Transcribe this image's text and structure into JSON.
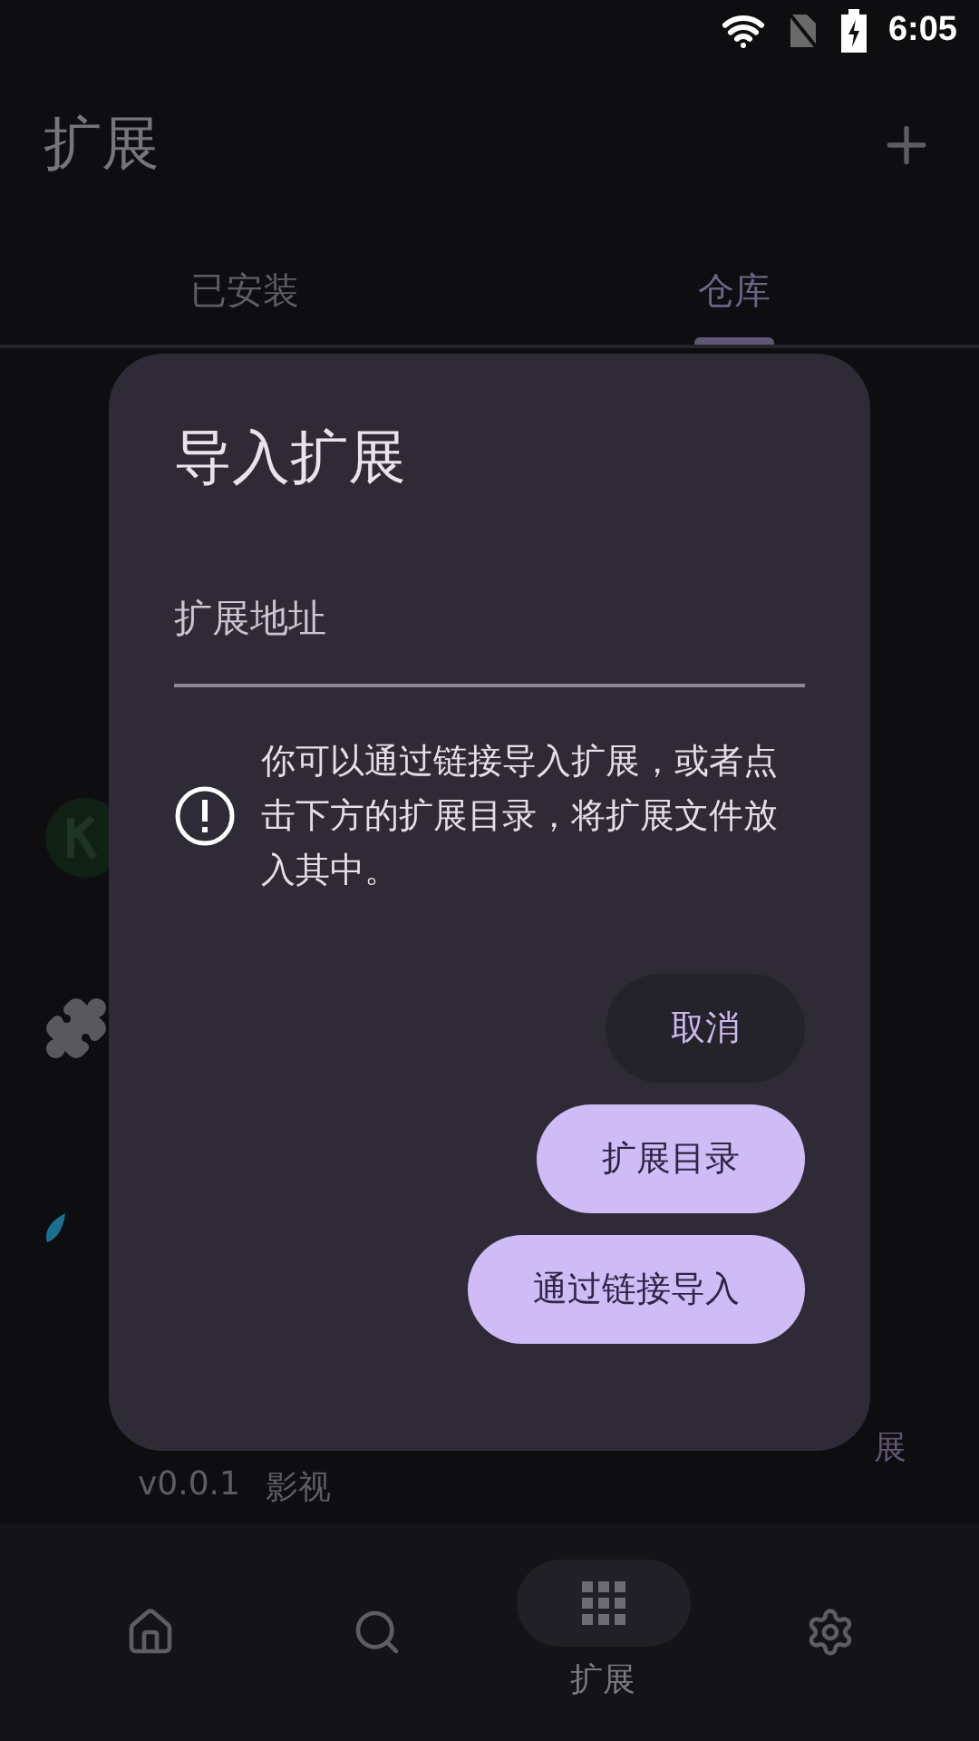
{
  "status_bar": {
    "time": "6:05"
  },
  "app_bar": {
    "title": "扩展"
  },
  "tabs": [
    {
      "label": "已安装",
      "selected": false
    },
    {
      "label": "仓库",
      "selected": true
    }
  ],
  "list_peek": {
    "version": "v0.0.1",
    "category": "影视",
    "action": "展"
  },
  "dialog": {
    "title": "导入扩展",
    "field": {
      "placeholder": "扩展地址"
    },
    "info": "你可以通过链接导入扩展，或者点击下方的扩展目录，将扩展文件放入其中。",
    "buttons": [
      {
        "label": "取消",
        "kind": "tonal"
      },
      {
        "label": "扩展目录",
        "kind": "filled"
      },
      {
        "label": "通过链接导入",
        "kind": "filled"
      }
    ]
  },
  "bottom_nav": [
    {
      "kind": "home",
      "selected": false
    },
    {
      "kind": "search",
      "selected": false
    },
    {
      "kind": "grid",
      "selected": true,
      "label": "扩展"
    },
    {
      "kind": "settings",
      "selected": false
    }
  ]
}
